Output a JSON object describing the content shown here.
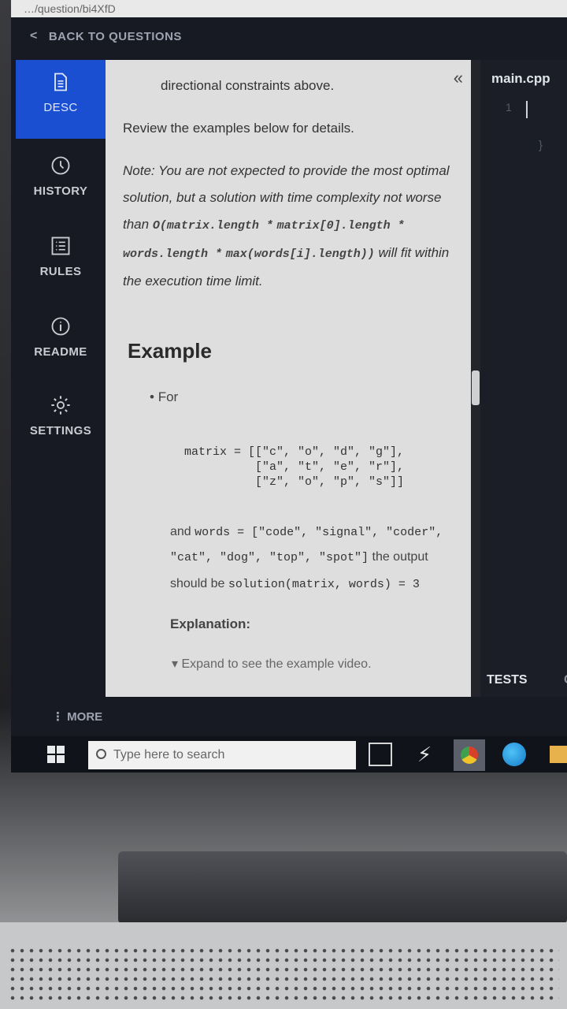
{
  "browser": {
    "url_fragment": "…/question/bi4XfD"
  },
  "header": {
    "back_label": "BACK TO QUESTIONS"
  },
  "nav": {
    "items": [
      {
        "label": "DESC",
        "icon": "document-icon",
        "active": true
      },
      {
        "label": "HISTORY",
        "icon": "clock-icon"
      },
      {
        "label": "RULES",
        "icon": "list-icon"
      },
      {
        "label": "README",
        "icon": "info-icon"
      },
      {
        "label": "SETTINGS",
        "icon": "gear-icon"
      }
    ],
    "more_label": "⋮ MORE"
  },
  "description": {
    "collapse_icon": "«",
    "p1": "directional constraints above.",
    "p2": "Review the examples below for details.",
    "note_prefix": "Note: You are not expected to provide the most optimal solution, but a solution with time complexity not worse than ",
    "note_code1": "O(matrix.length *",
    "note_code2": "matrix[0].length * words.length *",
    "note_code3": "max(words[i].length))",
    "note_suffix": " will fit within the execution time limit.",
    "example_heading": "Example",
    "bullet": "For",
    "matrix_code": "matrix = [[\"c\", \"o\", \"d\", \"g\"],\n          [\"a\", \"t\", \"e\", \"r\"],\n          [\"z\", \"o\", \"p\", \"s\"]]",
    "words_prefix": "and ",
    "words_code1": "words = [\"code\", \"signal\", \"coder\",",
    "words_code2": "\"cat\", \"dog\", \"top\", \"spot\"]",
    "output_text": " the output",
    "should_be": "should be ",
    "solution_code": "solution(matrix, words) = 3",
    "explanation_label": "Explanation:",
    "expand_label": "▾ Expand to see the example video."
  },
  "editor": {
    "file_tab": "main.cpp",
    "line_number": "1",
    "brace": "}",
    "tests_tab": "TESTS",
    "next_tab": "CU"
  },
  "taskbar": {
    "search_placeholder": "Type here to search"
  }
}
